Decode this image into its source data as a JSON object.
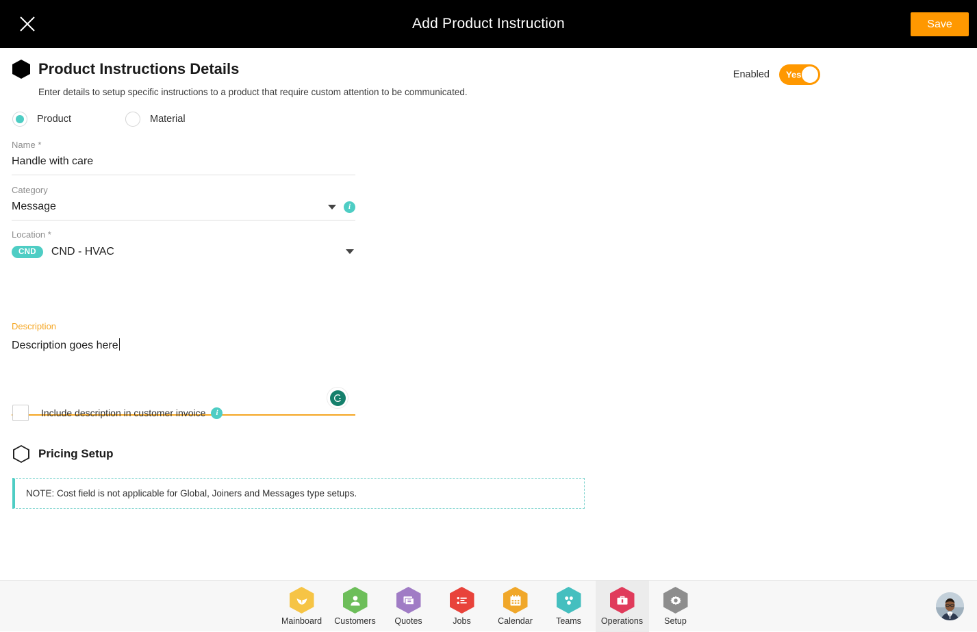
{
  "topbar": {
    "close_icon": "close-icon",
    "title": "Add Product Instruction",
    "save_label": "Save"
  },
  "section": {
    "title": "Product Instructions Details",
    "subtitle": "Enter details to setup specific instructions to a product that require custom attention to be communicated.",
    "hex_icon": "hexagon-filled-icon"
  },
  "enabled": {
    "label": "Enabled",
    "toggle_value": "Yes",
    "color": "#FF9800"
  },
  "type_radio": {
    "options": [
      {
        "label": "Product",
        "selected": true
      },
      {
        "label": "Material",
        "selected": false
      }
    ],
    "accent": "#4ECDC4"
  },
  "fields": {
    "name": {
      "label": "Name",
      "required_marker": "*",
      "value": "Handle with care"
    },
    "category": {
      "label": "Category",
      "required_marker": "",
      "value": "Message",
      "caret_icon": "chevron-down-icon",
      "info_icon": "info-icon",
      "info_glyph": "i"
    },
    "location": {
      "label": "Location",
      "required_marker": "*",
      "chip": "CND",
      "value": "CND - HVAC",
      "caret_icon": "chevron-down-icon"
    },
    "description": {
      "label": "Description",
      "value": "Description goes here",
      "helper_icon": "grammarly-icon",
      "helper_glyph": "G",
      "underline_color": "#F5A623"
    }
  },
  "invoice_checkbox": {
    "label": "Include description in customer invoice",
    "checked": false,
    "info_icon": "info-icon",
    "info_glyph": "i"
  },
  "pricing": {
    "title": "Pricing Setup",
    "hex_icon": "hexagon-outline-icon"
  },
  "note": {
    "text": "NOTE: Cost field is not applicable for Global, Joiners and Messages type setups.",
    "accent": "#4ECDC4"
  },
  "footer": {
    "nav": [
      {
        "label": "Mainboard",
        "icon": "mainboard-icon",
        "color": "#F6C445",
        "active": false
      },
      {
        "label": "Customers",
        "icon": "customers-icon",
        "color": "#6DBE5A",
        "active": false
      },
      {
        "label": "Quotes",
        "icon": "quotes-icon",
        "color": "#A07CC5",
        "active": false
      },
      {
        "label": "Jobs",
        "icon": "jobs-icon",
        "color": "#E8433B",
        "active": false
      },
      {
        "label": "Calendar",
        "icon": "calendar-icon",
        "color": "#F0A72A",
        "active": false
      },
      {
        "label": "Teams",
        "icon": "teams-icon",
        "color": "#45BFBF",
        "active": false
      },
      {
        "label": "Operations",
        "icon": "operations-icon",
        "color": "#E03B5B",
        "active": true
      },
      {
        "label": "Setup",
        "icon": "setup-icon",
        "color": "#8D8D8D",
        "active": false
      }
    ],
    "avatar": "user-avatar"
  }
}
